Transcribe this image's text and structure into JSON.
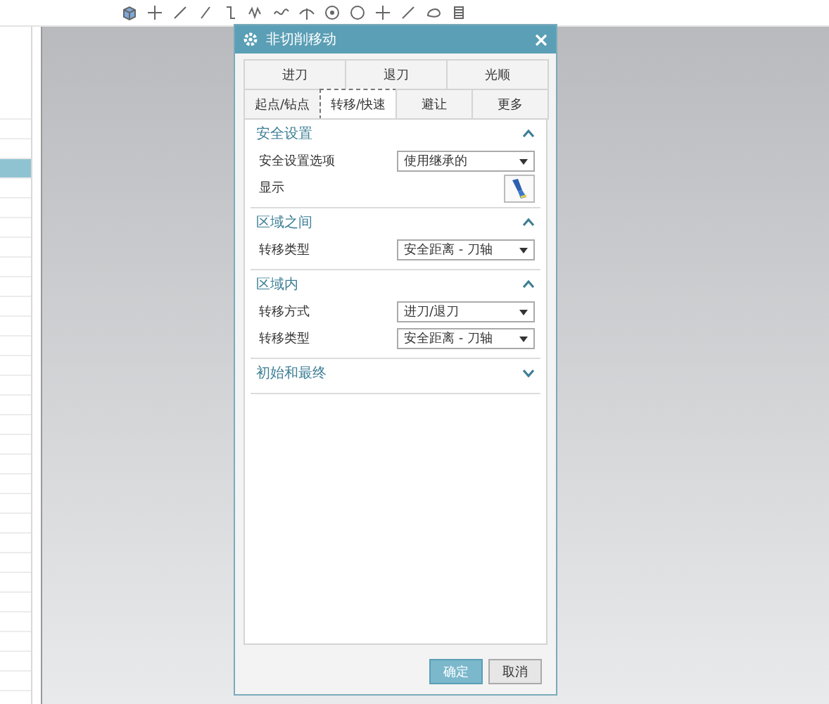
{
  "navigator": {
    "rows": [
      {
        "selected": false
      },
      {
        "selected": false
      },
      {
        "selected": false
      },
      {
        "selected": true
      },
      {
        "selected": false
      },
      {
        "selected": false
      },
      {
        "selected": false
      },
      {
        "selected": false
      },
      {
        "selected": false
      },
      {
        "selected": false
      },
      {
        "selected": false
      },
      {
        "selected": false
      },
      {
        "selected": false
      },
      {
        "selected": false
      },
      {
        "selected": false
      },
      {
        "selected": false
      },
      {
        "selected": false
      },
      {
        "selected": false
      },
      {
        "selected": false
      },
      {
        "selected": false
      },
      {
        "selected": false
      },
      {
        "selected": false
      },
      {
        "selected": false
      },
      {
        "selected": false
      },
      {
        "selected": false
      },
      {
        "selected": false
      },
      {
        "selected": false
      },
      {
        "selected": false
      },
      {
        "selected": false
      },
      {
        "selected": false
      }
    ]
  },
  "dialog": {
    "title": "非切削移动",
    "tab_rows": [
      [
        {
          "label": "进刀",
          "selected": false
        },
        {
          "label": "退刀",
          "selected": false
        },
        {
          "label": "光顺",
          "selected": false
        }
      ],
      [
        {
          "label": "起点/钻点",
          "selected": false
        },
        {
          "label": "转移/快速",
          "selected": true
        },
        {
          "label": "避让",
          "selected": false
        },
        {
          "label": "更多",
          "selected": false
        }
      ]
    ],
    "sections": [
      {
        "title": "安全设置",
        "expanded": true,
        "rows": [
          {
            "kind": "dropdown",
            "label": "安全设置选项",
            "value": "使用继承的"
          },
          {
            "kind": "button",
            "label": "显示"
          }
        ]
      },
      {
        "title": "区域之间",
        "expanded": true,
        "rows": [
          {
            "kind": "dropdown",
            "label": "转移类型",
            "value": "安全距离 - 刀轴"
          }
        ]
      },
      {
        "title": "区域内",
        "expanded": true,
        "rows": [
          {
            "kind": "dropdown",
            "label": "转移方式",
            "value": "进刀/退刀"
          },
          {
            "kind": "dropdown",
            "label": "转移类型",
            "value": "安全距离 - 刀轴"
          }
        ]
      },
      {
        "title": "初始和最终",
        "expanded": false
      }
    ],
    "buttons": [
      {
        "label": "确定",
        "primary": true
      },
      {
        "label": "取消",
        "primary": false
      }
    ]
  }
}
